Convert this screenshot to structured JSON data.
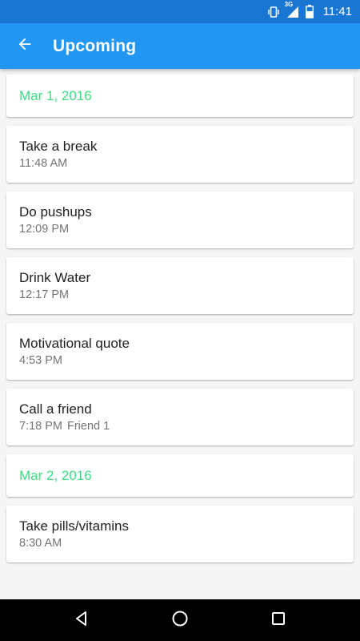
{
  "status_bar": {
    "network": "3G",
    "time": "11:41",
    "icons": [
      "vibrate-icon",
      "signal-icon",
      "battery-icon"
    ]
  },
  "app_bar": {
    "title": "Upcoming",
    "back_icon": "arrow-back-icon",
    "color": "#2196f3"
  },
  "groups": [
    {
      "date": "Mar 1, 2016",
      "items": [
        {
          "title": "Take a break",
          "time": "11:48 AM",
          "extra": ""
        },
        {
          "title": "Do pushups",
          "time": "12:09 PM",
          "extra": ""
        },
        {
          "title": "Drink Water",
          "time": "12:17 PM",
          "extra": ""
        },
        {
          "title": "Motivational quote",
          "time": "4:53 PM",
          "extra": ""
        },
        {
          "title": "Call a friend",
          "time": "7:18 PM",
          "extra": "Friend 1"
        }
      ]
    },
    {
      "date": "Mar 2, 2016",
      "items": [
        {
          "title": "Take pills/vitamins",
          "time": "8:30 AM",
          "extra": ""
        }
      ]
    }
  ],
  "nav_bar": {
    "buttons": [
      "back-triangle-icon",
      "home-circle-icon",
      "recents-square-icon"
    ]
  },
  "colors": {
    "date_accent": "#3ddc84",
    "status_bar": "#1976d2"
  }
}
